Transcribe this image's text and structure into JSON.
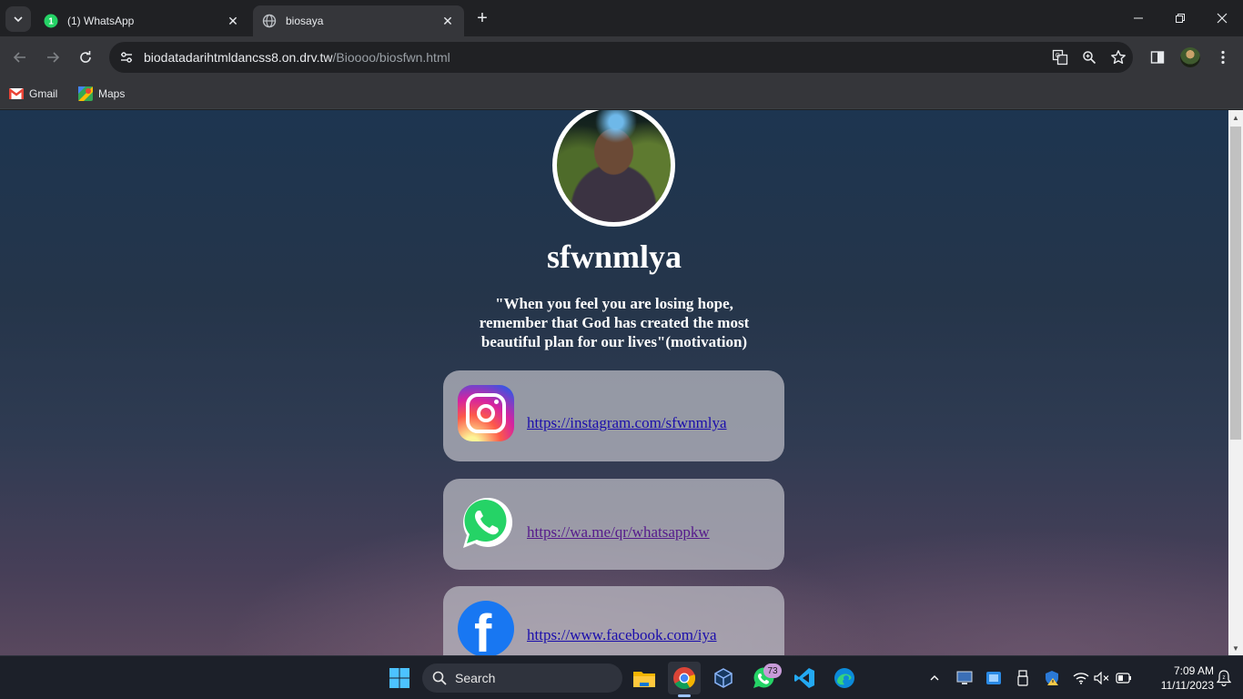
{
  "browser": {
    "tabs": [
      {
        "title": "(1) WhatsApp",
        "active": false,
        "favicon": "whatsapp-icon"
      },
      {
        "title": "biosaya",
        "active": true,
        "favicon": "globe-icon"
      }
    ],
    "url_host": "biodatadarihtmldancss8.on.drv.tw",
    "url_path": "/Bioooo/biosfwn.html",
    "bookmarks": [
      {
        "label": "Gmail",
        "icon": "gmail-icon"
      },
      {
        "label": "Maps",
        "icon": "maps-icon"
      }
    ]
  },
  "page": {
    "name": "sfwnmlya",
    "quote": "\"When you feel you are losing hope, remember that God has created the most beautiful plan for our lives\"(motivation)",
    "links": [
      {
        "platform": "instagram",
        "url": "https://instagram.com/sfwnmlya"
      },
      {
        "platform": "whatsapp",
        "url": "https://wa.me/qr/whatsappkw"
      },
      {
        "platform": "facebook",
        "url": "https://www.facebook.com/iya"
      }
    ]
  },
  "taskbar": {
    "search_placeholder": "Search",
    "whatsapp_badge": "73",
    "time": "7:09 AM",
    "date": "11/11/2023"
  },
  "colors": {
    "link_unvisited": "#1a0dab",
    "link_visited": "#551a8b",
    "card_bg": "#bebec6",
    "facebook_blue": "#1877f2",
    "whatsapp_green": "#25d366"
  }
}
